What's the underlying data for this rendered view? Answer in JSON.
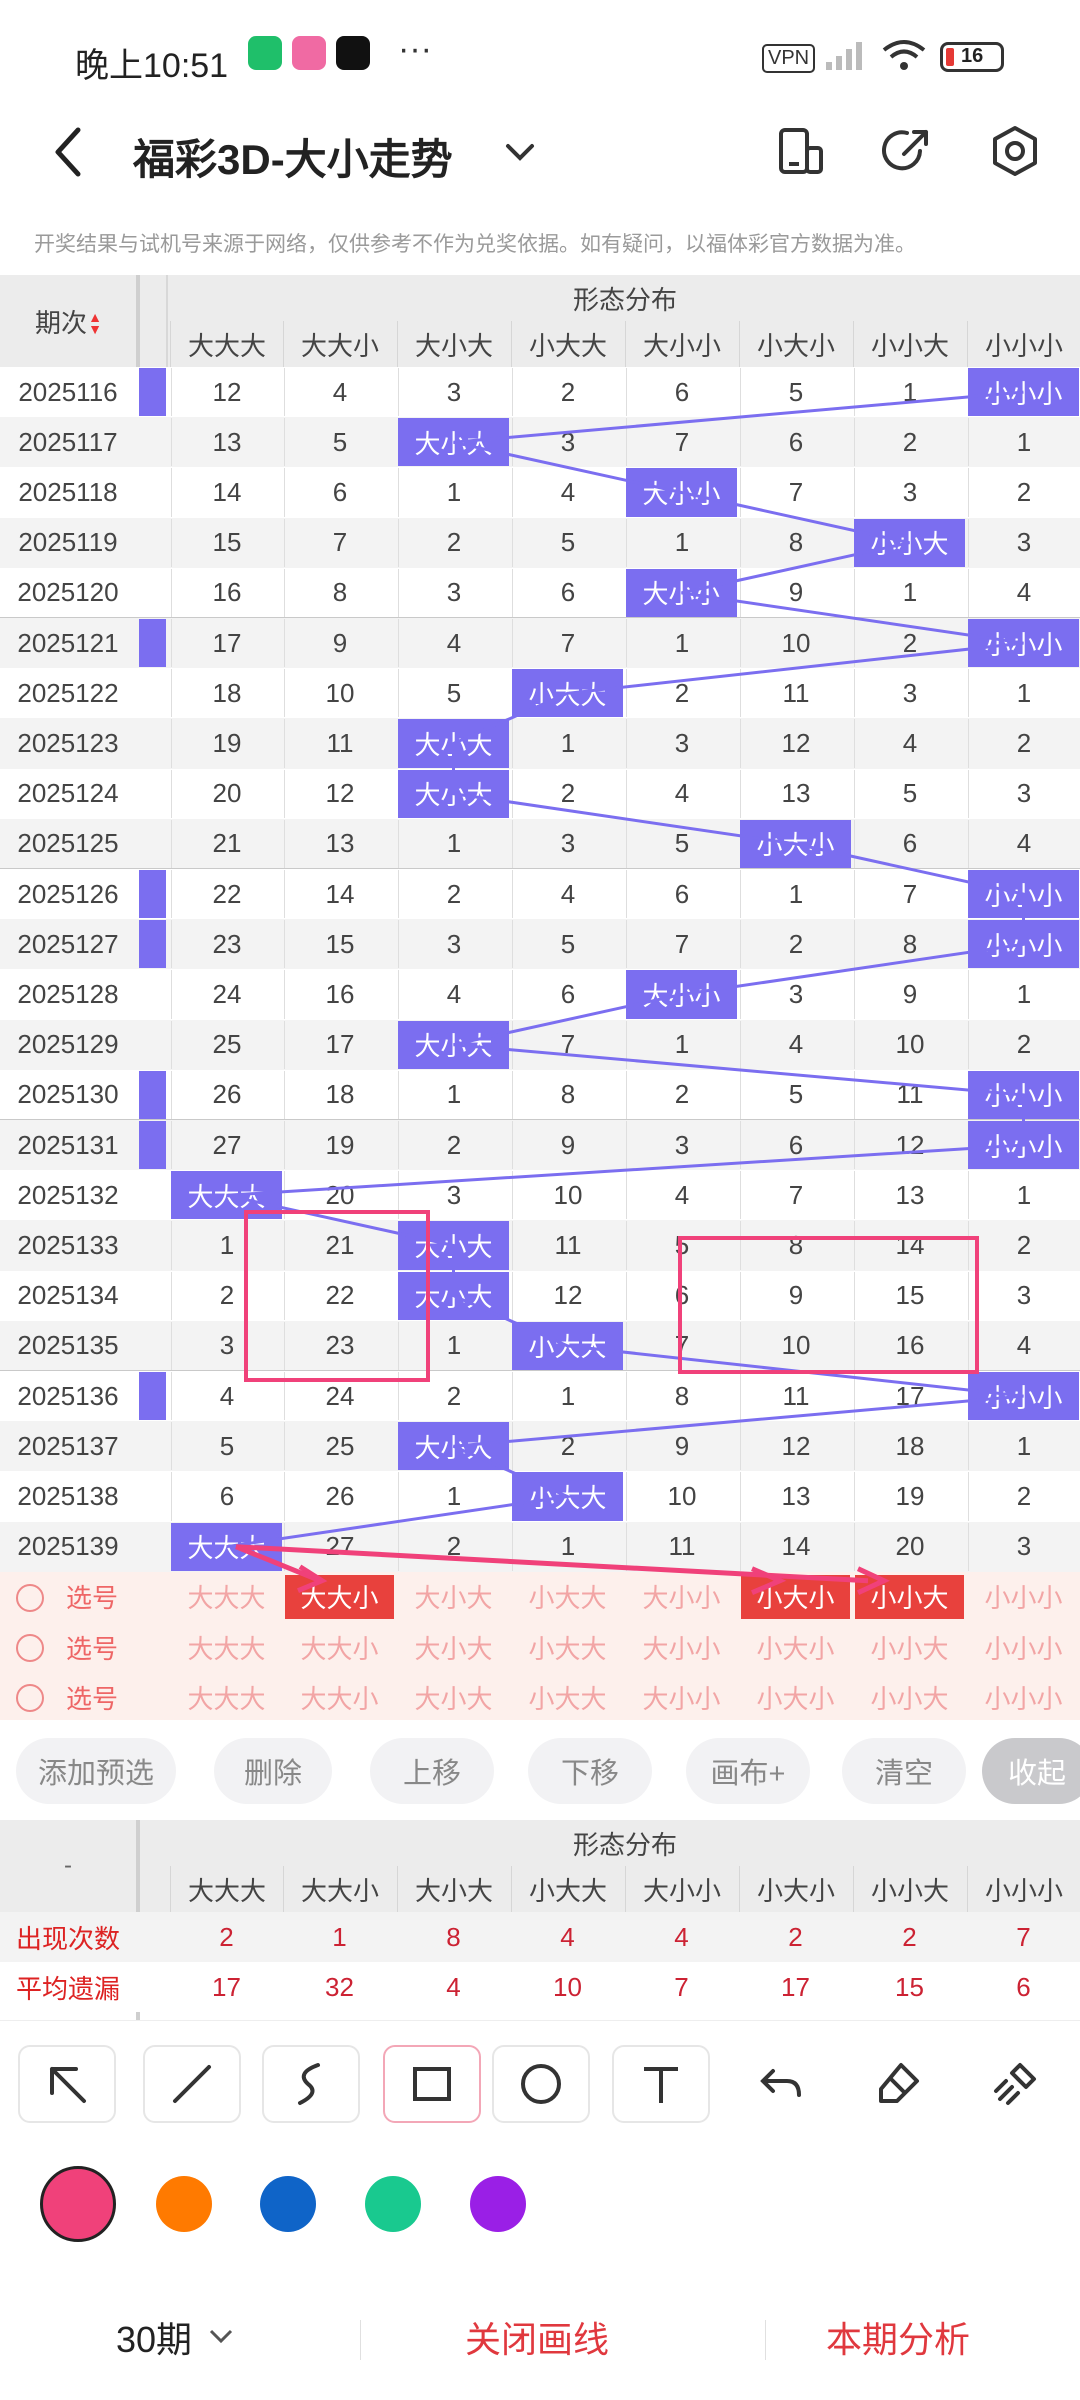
{
  "status_bar": {
    "time": "晚上10:51",
    "more": "···",
    "vpn": "VPN",
    "battery": "16"
  },
  "header": {
    "title": "福彩3D-大小走势",
    "dropdown": "⌄"
  },
  "notice": "开奖结果与试机号来源于网络，仅供参考不作为兑奖依据。如有疑问，以福体彩官方数据为准。",
  "table": {
    "period_header": "期次",
    "sort_arrows": "▲▼",
    "group_header": "形态分布",
    "columns": [
      "大大大",
      "大大小",
      "大小大",
      "小大大",
      "大小小",
      "小大小",
      "小小大",
      "小小小"
    ],
    "rows": [
      {
        "period": "2025116",
        "values": [
          "12",
          "4",
          "3",
          "2",
          "6",
          "5",
          "1",
          "小小小"
        ],
        "hit": 7
      },
      {
        "period": "2025117",
        "values": [
          "13",
          "5",
          "大小大",
          "3",
          "7",
          "6",
          "2",
          "1"
        ],
        "hit": 2
      },
      {
        "period": "2025118",
        "values": [
          "14",
          "6",
          "1",
          "4",
          "大小小",
          "7",
          "3",
          "2"
        ],
        "hit": 4
      },
      {
        "period": "2025119",
        "values": [
          "15",
          "7",
          "2",
          "5",
          "1",
          "8",
          "小小大",
          "3"
        ],
        "hit": 6
      },
      {
        "period": "2025120",
        "values": [
          "16",
          "8",
          "3",
          "6",
          "大小小",
          "9",
          "1",
          "4"
        ],
        "hit": 4
      },
      {
        "period": "2025121",
        "values": [
          "17",
          "9",
          "4",
          "7",
          "1",
          "10",
          "2",
          "小小小"
        ],
        "hit": 7
      },
      {
        "period": "2025122",
        "values": [
          "18",
          "10",
          "5",
          "小大大",
          "2",
          "11",
          "3",
          "1"
        ],
        "hit": 3
      },
      {
        "period": "2025123",
        "values": [
          "19",
          "11",
          "大小大",
          "1",
          "3",
          "12",
          "4",
          "2"
        ],
        "hit": 2
      },
      {
        "period": "2025124",
        "values": [
          "20",
          "12",
          "大小大",
          "2",
          "4",
          "13",
          "5",
          "3"
        ],
        "hit": 2
      },
      {
        "period": "2025125",
        "values": [
          "21",
          "13",
          "1",
          "3",
          "5",
          "小大小",
          "6",
          "4"
        ],
        "hit": 5
      },
      {
        "period": "2025126",
        "values": [
          "22",
          "14",
          "2",
          "4",
          "6",
          "1",
          "7",
          "小小小"
        ],
        "hit": 7
      },
      {
        "period": "2025127",
        "values": [
          "23",
          "15",
          "3",
          "5",
          "7",
          "2",
          "8",
          "小小小"
        ],
        "hit": 7
      },
      {
        "period": "2025128",
        "values": [
          "24",
          "16",
          "4",
          "6",
          "大小小",
          "3",
          "9",
          "1"
        ],
        "hit": 4
      },
      {
        "period": "2025129",
        "values": [
          "25",
          "17",
          "大小大",
          "7",
          "1",
          "4",
          "10",
          "2"
        ],
        "hit": 2
      },
      {
        "period": "2025130",
        "values": [
          "26",
          "18",
          "1",
          "8",
          "2",
          "5",
          "11",
          "小小小"
        ],
        "hit": 7
      },
      {
        "period": "2025131",
        "values": [
          "27",
          "19",
          "2",
          "9",
          "3",
          "6",
          "12",
          "小小小"
        ],
        "hit": 7
      },
      {
        "period": "2025132",
        "values": [
          "大大大",
          "20",
          "3",
          "10",
          "4",
          "7",
          "13",
          "1"
        ],
        "hit": 0
      },
      {
        "period": "2025133",
        "values": [
          "1",
          "21",
          "大小大",
          "11",
          "5",
          "8",
          "14",
          "2"
        ],
        "hit": 2
      },
      {
        "period": "2025134",
        "values": [
          "2",
          "22",
          "大小大",
          "12",
          "6",
          "9",
          "15",
          "3"
        ],
        "hit": 2
      },
      {
        "period": "2025135",
        "values": [
          "3",
          "23",
          "1",
          "小大大",
          "7",
          "10",
          "16",
          "4"
        ],
        "hit": 3
      },
      {
        "period": "2025136",
        "values": [
          "4",
          "24",
          "2",
          "1",
          "8",
          "11",
          "17",
          "小小小"
        ],
        "hit": 7
      },
      {
        "period": "2025137",
        "values": [
          "5",
          "25",
          "大小大",
          "2",
          "9",
          "12",
          "18",
          "1"
        ],
        "hit": 2
      },
      {
        "period": "2025138",
        "values": [
          "6",
          "26",
          "1",
          "小大大",
          "10",
          "13",
          "19",
          "2"
        ],
        "hit": 3
      },
      {
        "period": "2025139",
        "values": [
          "大大大",
          "27",
          "2",
          "1",
          "11",
          "14",
          "20",
          "3"
        ],
        "hit": 0
      }
    ],
    "pick_rows": [
      {
        "label": "选号",
        "selected": [
          1,
          5,
          6
        ]
      },
      {
        "label": "选号",
        "selected": []
      },
      {
        "label": "选号",
        "selected": []
      }
    ]
  },
  "actions": [
    "添加预选",
    "删除",
    "上移",
    "下移",
    "画布+",
    "清空",
    "收起"
  ],
  "stats": {
    "corner": "-",
    "group_header": "形态分布",
    "rows": [
      {
        "label": "出现次数",
        "values": [
          "2",
          "1",
          "8",
          "4",
          "4",
          "2",
          "2",
          "7"
        ]
      },
      {
        "label": "平均遗漏",
        "values": [
          "17",
          "32",
          "4",
          "10",
          "7",
          "17",
          "15",
          "6"
        ]
      }
    ]
  },
  "tools": [
    "arrow-tool",
    "line-tool",
    "freehand-tool",
    "rectangle-tool",
    "circle-tool",
    "text-tool",
    "undo-tool",
    "eraser-tool",
    "clear-tool"
  ],
  "colors": [
    "#f0417a",
    "#ff7a00",
    "#0f64c8",
    "#19c98f",
    "#9a1fe6"
  ],
  "bottom": {
    "period_select": "30期",
    "close_lines": "关闭画线",
    "analysis": "本期分析"
  },
  "accent": "#7b6ef0",
  "draw_color": "#f0417a"
}
